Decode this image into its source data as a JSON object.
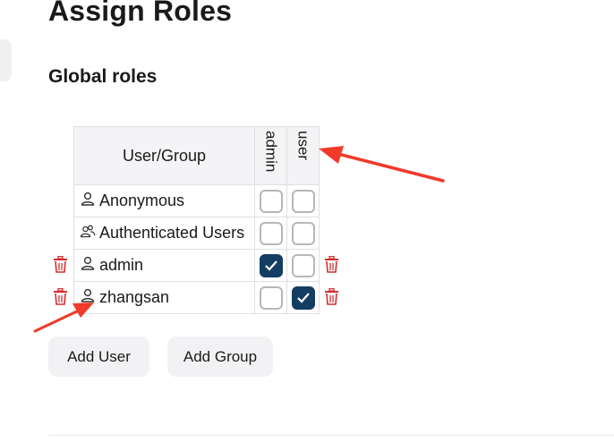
{
  "page": {
    "title": "Assign Roles"
  },
  "section": {
    "title": "Global roles"
  },
  "table": {
    "user_group_header": "User/Group",
    "roles": [
      "admin",
      "user"
    ],
    "rows": [
      {
        "name": "Anonymous",
        "icon": "user-icon",
        "checked": [
          false,
          false
        ],
        "deletable": false
      },
      {
        "name": "Authenticated Users",
        "icon": "group-icon",
        "checked": [
          false,
          false
        ],
        "deletable": false
      },
      {
        "name": "admin",
        "icon": "user-icon",
        "checked": [
          true,
          false
        ],
        "deletable": true
      },
      {
        "name": "zhangsan",
        "icon": "user-icon",
        "checked": [
          false,
          true
        ],
        "deletable": true
      }
    ]
  },
  "buttons": {
    "add_user": "Add User",
    "add_group": "Add Group"
  },
  "colors": {
    "checked": "#143d63",
    "trash": "#d32f2f",
    "annotation_arrow": "#f03a2a"
  }
}
